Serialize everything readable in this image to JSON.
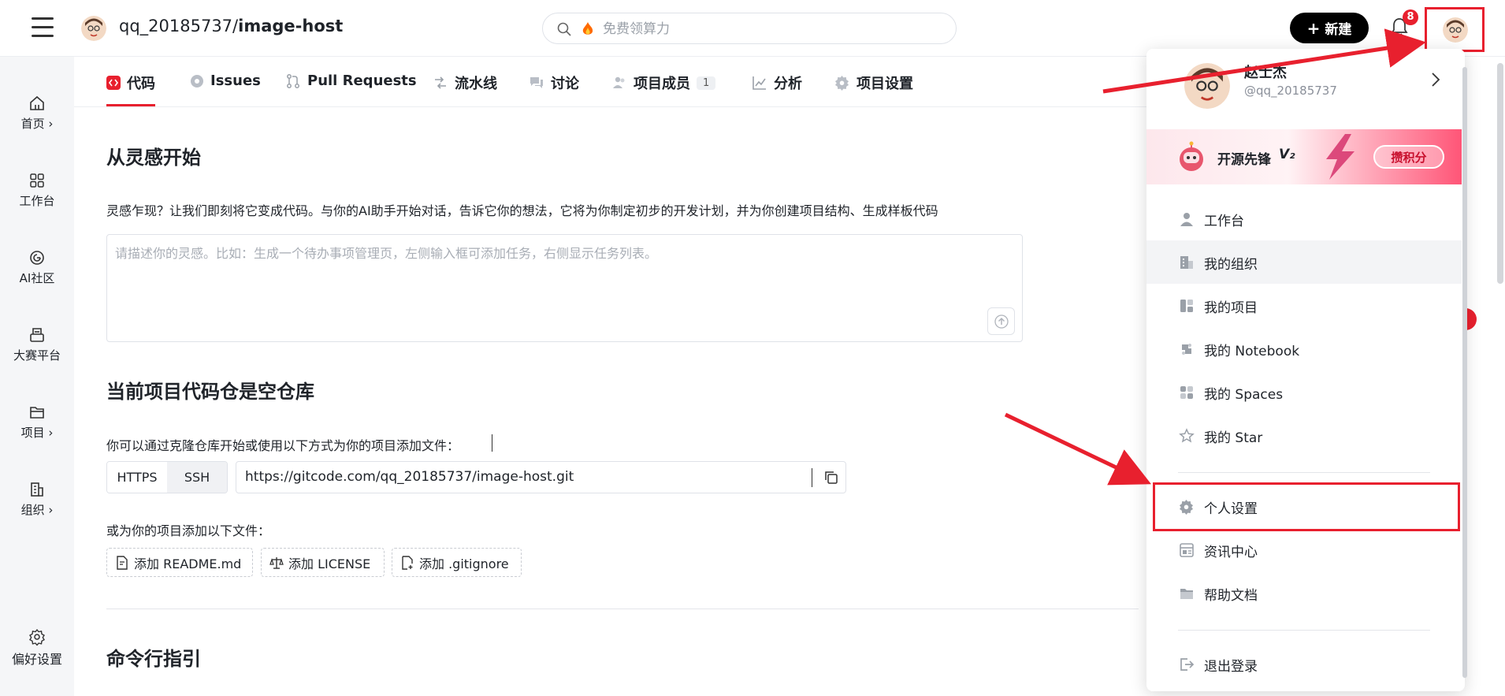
{
  "topbar": {
    "repo_owner": "qq_20185737/",
    "repo_name": "image-host",
    "search_placeholder": "免费领算力",
    "new_button": "新建",
    "notification_count": "8"
  },
  "sidebar": {
    "items": [
      {
        "label": "首页 ›"
      },
      {
        "label": "工作台"
      },
      {
        "label": "AI社区"
      },
      {
        "label": "大赛平台"
      },
      {
        "label": "项目 ›"
      },
      {
        "label": "组织 ›"
      },
      {
        "label": "偏好设置"
      }
    ]
  },
  "tabs": [
    {
      "label": "代码"
    },
    {
      "label": "Issues"
    },
    {
      "label": "Pull Requests"
    },
    {
      "label": "流水线"
    },
    {
      "label": "讨论"
    },
    {
      "label": "项目成员",
      "count": "1"
    },
    {
      "label": "分析"
    },
    {
      "label": "项目设置"
    }
  ],
  "inspiration": {
    "title": "从灵感开始",
    "description": "灵感乍现？让我们即刻将它变成代码。与你的AI助手开始对话，告诉它你的想法，它将为你制定初步的开发计划，并为你创建项目结构、生成样板代码",
    "placeholder": "请描述你的灵感。比如：生成一个待办事项管理页，左侧输入框可添加任务，右侧显示任务列表。"
  },
  "empty_repo": {
    "title": "当前项目代码仓是空仓库",
    "clone_hint": "你可以通过克隆仓库开始或使用以下方式为你的项目添加文件：",
    "protocols": [
      "HTTPS",
      "SSH"
    ],
    "clone_url": "https://gitcode.com/qq_20185737/image-host.git",
    "add_files_hint": "或为你的项目添加以下文件：",
    "add_buttons": [
      "添加 README.md",
      "添加 LICENSE",
      "添加 .gitignore"
    ]
  },
  "cli": {
    "title": "命令行指引"
  },
  "user_menu": {
    "name": "赵士杰",
    "handle": "@qq_20185737",
    "banner_title": "开源先锋",
    "banner_level": "V₂",
    "banner_button": "攒积分",
    "items": [
      {
        "label": "工作台"
      },
      {
        "label": "我的组织"
      },
      {
        "label": "我的项目"
      },
      {
        "label": "我的 Notebook"
      },
      {
        "label": "我的 Spaces"
      },
      {
        "label": "我的 Star"
      },
      {
        "label": "个人设置"
      },
      {
        "label": "资讯中心"
      },
      {
        "label": "帮助文档"
      },
      {
        "label": "退出登录"
      }
    ]
  },
  "colors": {
    "accent": "#e8202e",
    "dark_button": "#000000",
    "sidebar_bg": "#f5f6f8"
  }
}
